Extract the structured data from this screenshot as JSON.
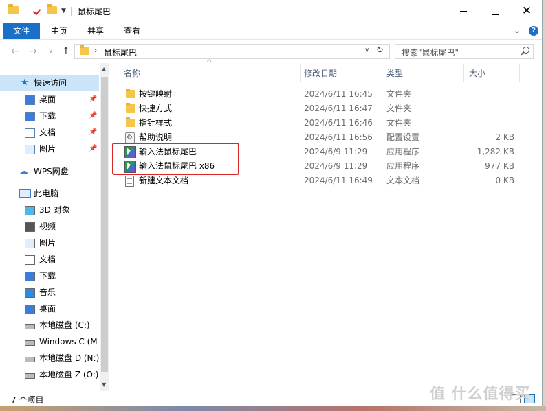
{
  "window": {
    "title": "鼠标尾巴",
    "controls": {
      "minimize": "—",
      "maximize": "□",
      "close": "✕"
    }
  },
  "ribbon": {
    "tabs": [
      "文件",
      "主页",
      "共享",
      "查看"
    ],
    "chevron": "⌄",
    "help": "?"
  },
  "address": {
    "path": "鼠标尾巴",
    "separator": "›",
    "dropdown": "∨",
    "search_placeholder": "搜索\"鼠标尾巴\""
  },
  "nav_arrows": {
    "back": "←",
    "forward": "→",
    "recent": "∨",
    "up": "↑"
  },
  "sidebar": {
    "quick_access": "快速访问",
    "pinned": [
      {
        "label": "桌面",
        "icon": "desktop-icon"
      },
      {
        "label": "下载",
        "icon": "download-icon"
      },
      {
        "label": "文档",
        "icon": "document-icon"
      },
      {
        "label": "图片",
        "icon": "picture-icon"
      }
    ],
    "wps": "WPS网盘",
    "this_pc": "此电脑",
    "pc_items": [
      {
        "label": "3D 对象",
        "icon": "3d-objects-icon"
      },
      {
        "label": "视频",
        "icon": "video-icon"
      },
      {
        "label": "图片",
        "icon": "picture-icon"
      },
      {
        "label": "文档",
        "icon": "document-icon"
      },
      {
        "label": "下载",
        "icon": "download-icon"
      },
      {
        "label": "音乐",
        "icon": "music-icon"
      },
      {
        "label": "桌面",
        "icon": "desktop-icon"
      },
      {
        "label": "本地磁盘 (C:)",
        "icon": "drive-icon"
      },
      {
        "label": "Windows C (M",
        "icon": "drive-icon"
      },
      {
        "label": "本地磁盘 D (N:)",
        "icon": "drive-icon"
      },
      {
        "label": "本地磁盘 Z (O:)",
        "icon": "drive-icon"
      }
    ]
  },
  "columns": {
    "name": "名称",
    "date": "修改日期",
    "type": "类型",
    "size": "大小"
  },
  "files": [
    {
      "name": "按键映射",
      "date": "2024/6/11 16:45",
      "type": "文件夹",
      "size": "",
      "icon": "folder-icon"
    },
    {
      "name": "快捷方式",
      "date": "2024/6/11 16:47",
      "type": "文件夹",
      "size": "",
      "icon": "folder-icon"
    },
    {
      "name": "指针样式",
      "date": "2024/6/11 16:46",
      "type": "文件夹",
      "size": "",
      "icon": "folder-icon"
    },
    {
      "name": "帮助说明",
      "date": "2024/6/11 16:56",
      "type": "配置设置",
      "size": "2 KB",
      "icon": "config-file-icon"
    },
    {
      "name": "输入法鼠标尾巴",
      "date": "2024/6/9 11:29",
      "type": "应用程序",
      "size": "1,282 KB",
      "icon": "app-icon"
    },
    {
      "name": "输入法鼠标尾巴 x86",
      "date": "2024/6/9 11:29",
      "type": "应用程序",
      "size": "977 KB",
      "icon": "app-icon"
    },
    {
      "name": "新建文本文档",
      "date": "2024/6/11 16:49",
      "type": "文本文档",
      "size": "0 KB",
      "icon": "text-file-icon"
    }
  ],
  "status": {
    "count": "7 个项目"
  },
  "watermark": "值 什么值得买",
  "colors": {
    "accent": "#1a6fc6",
    "selection": "#cce4f7",
    "highlight_box": "#d9272a"
  }
}
